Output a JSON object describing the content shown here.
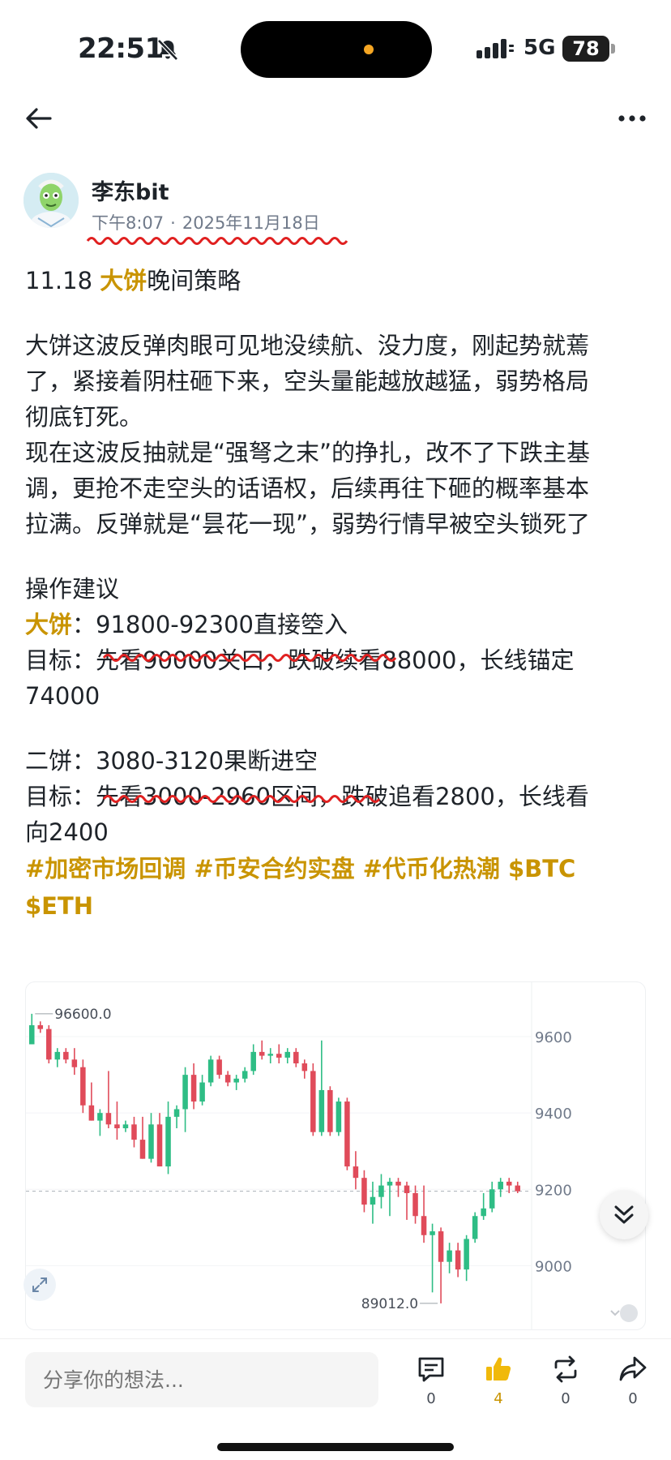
{
  "status": {
    "time": "22:51",
    "network": "5G",
    "battery": "78",
    "icons": [
      "bell-muted-icon",
      "signal-icon",
      "battery-icon"
    ]
  },
  "nav": {
    "back_icon": "arrow-left-icon",
    "more_icon": "more-dots-icon"
  },
  "author": {
    "name": "李东bit",
    "time_of_day": "下午8:07",
    "separator": "·",
    "date": "2025年11月18日"
  },
  "post": {
    "title_prefix": "11.18 ",
    "title_highlight": "大饼",
    "title_suffix": "晚间策略",
    "para1": [
      "大饼这波反弹肉眼可见地没续航、没力度，刚起势就蔫",
      "了，紧接着阴柱砸下来，空头量能越放越猛，弱势格局",
      "彻底钉死。",
      "现在这波反抽就是“强弩之末”的挣扎，改不了下跌主基",
      "调，更抢不走空头的话语权，后续再往下砸的概率基本",
      "拉满。反弹就是“昙花一现”，弱势行情早被空头锁死了"
    ],
    "advice_heading": "操作建议",
    "btc_label": "大饼",
    "btc_colon": "：",
    "btc_entry": "91800-92300直接箜入",
    "btc_target_line1": "目标：先看90000关口，跌破续看88000，长线锚定",
    "btc_target_line2": "74000",
    "eth_label": "二饼：",
    "eth_entry": "3080-3120果断进空",
    "eth_target_line1": "目标：先看3000-2960区间，跌破追看2800，长线看",
    "eth_target_line2": "向2400",
    "tags_line1": [
      "#加密市场回调",
      "#币安合约实盘",
      "#代币化热潮",
      "$BTC"
    ],
    "tags_line2": [
      "$ETH"
    ]
  },
  "colors": {
    "accent": "#c99400",
    "up": "#2ebd85",
    "down": "#e04b5a",
    "squiggle": "#e02020"
  },
  "chart_data": {
    "type": "candlestick",
    "high_label": "96600.0",
    "low_label": "89012.0",
    "y_tick_labels": [
      "9600",
      "9400",
      "9200",
      "9000"
    ],
    "y_ticks": [
      96000,
      94000,
      92000,
      90000
    ],
    "ylim": [
      88500,
      97000
    ],
    "last_price": 91950,
    "candles": [
      {
        "o": 95800,
        "h": 96600,
        "l": 95800,
        "c": 96300
      },
      {
        "o": 96300,
        "h": 96400,
        "l": 96100,
        "c": 96200
      },
      {
        "o": 96200,
        "h": 96300,
        "l": 95300,
        "c": 95400
      },
      {
        "o": 95400,
        "h": 95700,
        "l": 95200,
        "c": 95600
      },
      {
        "o": 95600,
        "h": 95700,
        "l": 95300,
        "c": 95400
      },
      {
        "o": 95400,
        "h": 95700,
        "l": 95000,
        "c": 95200
      },
      {
        "o": 95200,
        "h": 95400,
        "l": 94000,
        "c": 94200
      },
      {
        "o": 94200,
        "h": 94800,
        "l": 93800,
        "c": 93800
      },
      {
        "o": 93800,
        "h": 94100,
        "l": 93400,
        "c": 94000
      },
      {
        "o": 94000,
        "h": 95100,
        "l": 93600,
        "c": 93700
      },
      {
        "o": 93700,
        "h": 94300,
        "l": 93300,
        "c": 93600
      },
      {
        "o": 93600,
        "h": 93800,
        "l": 93500,
        "c": 93700
      },
      {
        "o": 93700,
        "h": 93900,
        "l": 93100,
        "c": 93300
      },
      {
        "o": 93300,
        "h": 93900,
        "l": 92800,
        "c": 92800
      },
      {
        "o": 92800,
        "h": 94000,
        "l": 92700,
        "c": 93700
      },
      {
        "o": 93700,
        "h": 94000,
        "l": 92600,
        "c": 92600
      },
      {
        "o": 92600,
        "h": 94300,
        "l": 92400,
        "c": 93900
      },
      {
        "o": 93900,
        "h": 94200,
        "l": 93600,
        "c": 94100
      },
      {
        "o": 94100,
        "h": 95200,
        "l": 93500,
        "c": 95000
      },
      {
        "o": 95000,
        "h": 95300,
        "l": 94100,
        "c": 94300
      },
      {
        "o": 94300,
        "h": 95000,
        "l": 94200,
        "c": 94800
      },
      {
        "o": 94800,
        "h": 95500,
        "l": 94700,
        "c": 95400
      },
      {
        "o": 95400,
        "h": 95500,
        "l": 94900,
        "c": 95000
      },
      {
        "o": 95000,
        "h": 95100,
        "l": 94700,
        "c": 94800
      },
      {
        "o": 94800,
        "h": 95000,
        "l": 94600,
        "c": 94900
      },
      {
        "o": 94900,
        "h": 95200,
        "l": 94800,
        "c": 95100
      },
      {
        "o": 95100,
        "h": 95800,
        "l": 95000,
        "c": 95600
      },
      {
        "o": 95600,
        "h": 95900,
        "l": 95400,
        "c": 95500
      },
      {
        "o": 95500,
        "h": 95700,
        "l": 95300,
        "c": 95550
      },
      {
        "o": 95550,
        "h": 95800,
        "l": 95300,
        "c": 95450
      },
      {
        "o": 95450,
        "h": 95700,
        "l": 95300,
        "c": 95600
      },
      {
        "o": 95600,
        "h": 95700,
        "l": 95200,
        "c": 95300
      },
      {
        "o": 95300,
        "h": 95400,
        "l": 94900,
        "c": 95100
      },
      {
        "o": 95100,
        "h": 95300,
        "l": 93400,
        "c": 93500
      },
      {
        "o": 93500,
        "h": 95900,
        "l": 93400,
        "c": 94600
      },
      {
        "o": 94600,
        "h": 94700,
        "l": 93400,
        "c": 93500
      },
      {
        "o": 93500,
        "h": 94400,
        "l": 93400,
        "c": 94300
      },
      {
        "o": 94300,
        "h": 94400,
        "l": 92500,
        "c": 92600
      },
      {
        "o": 92600,
        "h": 93000,
        "l": 92000,
        "c": 92300
      },
      {
        "o": 92300,
        "h": 92500,
        "l": 91400,
        "c": 91600
      },
      {
        "o": 91600,
        "h": 92200,
        "l": 91100,
        "c": 91800
      },
      {
        "o": 91800,
        "h": 92400,
        "l": 91500,
        "c": 92100
      },
      {
        "o": 92100,
        "h": 92300,
        "l": 91300,
        "c": 92200
      },
      {
        "o": 92200,
        "h": 92300,
        "l": 91800,
        "c": 92100
      },
      {
        "o": 92100,
        "h": 92200,
        "l": 91200,
        "c": 91900
      },
      {
        "o": 91900,
        "h": 92100,
        "l": 91100,
        "c": 91300
      },
      {
        "o": 91300,
        "h": 92100,
        "l": 90600,
        "c": 90800
      },
      {
        "o": 90800,
        "h": 91100,
        "l": 89300,
        "c": 90900
      },
      {
        "o": 90900,
        "h": 91000,
        "l": 89012,
        "c": 90100
      },
      {
        "o": 90100,
        "h": 90600,
        "l": 89800,
        "c": 90400
      },
      {
        "o": 90400,
        "h": 90600,
        "l": 89700,
        "c": 89900
      },
      {
        "o": 89900,
        "h": 90800,
        "l": 89600,
        "c": 90700
      },
      {
        "o": 90700,
        "h": 91400,
        "l": 90600,
        "c": 91300
      },
      {
        "o": 91300,
        "h": 91900,
        "l": 91200,
        "c": 91500
      },
      {
        "o": 91500,
        "h": 92200,
        "l": 91400,
        "c": 92000
      },
      {
        "o": 92000,
        "h": 92300,
        "l": 91800,
        "c": 92200
      },
      {
        "o": 92200,
        "h": 92300,
        "l": 91900,
        "c": 92100
      },
      {
        "o": 92100,
        "h": 92200,
        "l": 91900,
        "c": 91950
      }
    ]
  },
  "bottom": {
    "comment_placeholder": "分享你的想法...",
    "actions": [
      {
        "icon": "comment-icon",
        "count": "0"
      },
      {
        "icon": "like-icon",
        "count": "4"
      },
      {
        "icon": "repost-icon",
        "count": "0"
      },
      {
        "icon": "share-icon",
        "count": "0"
      }
    ]
  }
}
